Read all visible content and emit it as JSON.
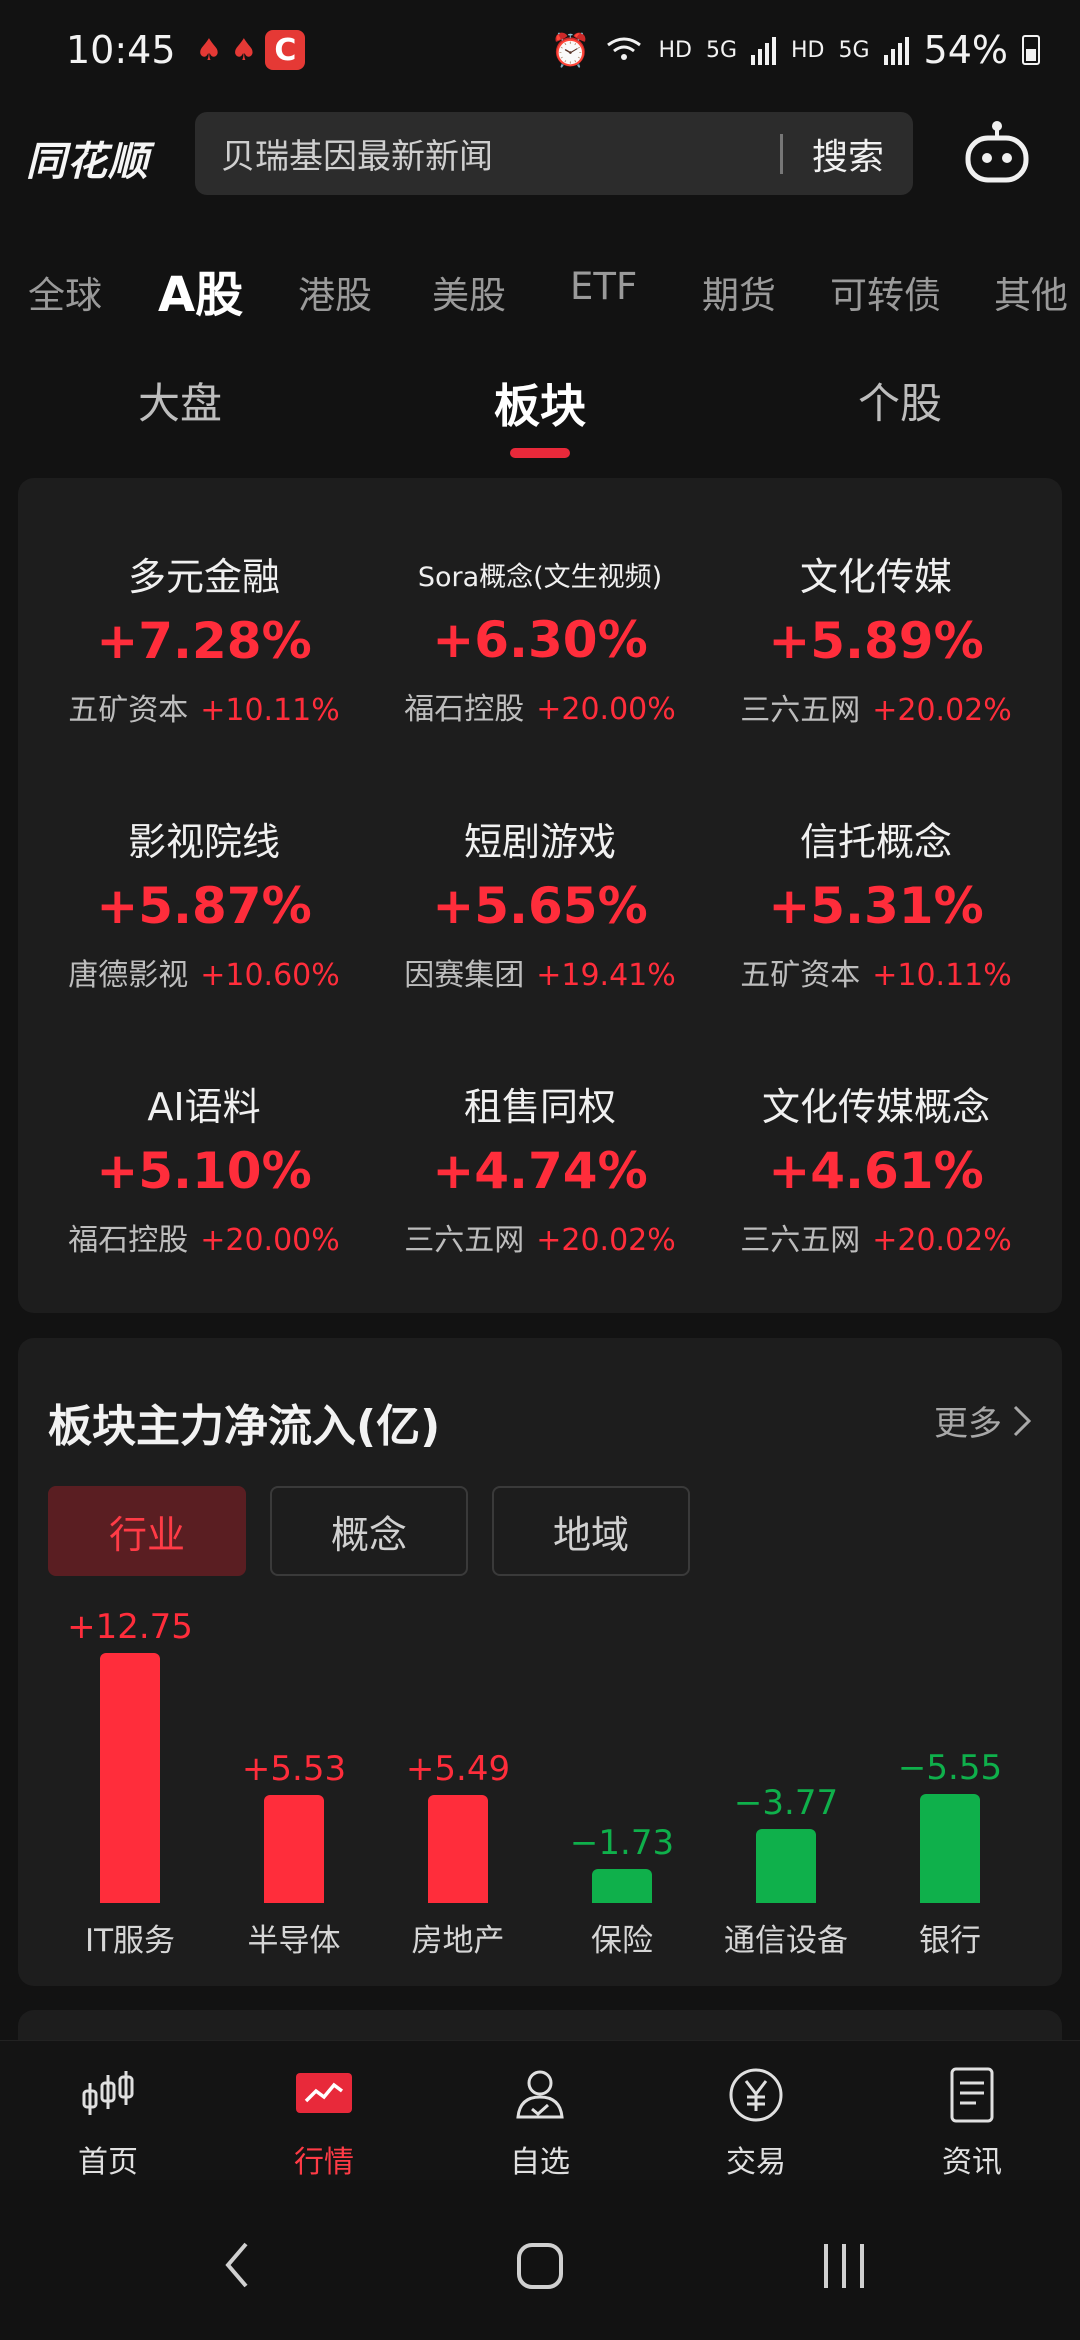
{
  "status": {
    "time": "10:45",
    "battery": "54%",
    "net1": "HD",
    "net2": "5G",
    "net3": "HD",
    "net4": "5G",
    "notif_c": "C"
  },
  "header": {
    "logo": "同花顺",
    "search_placeholder": "贝瑞基因最新新闻",
    "search_button": "搜索"
  },
  "market_tabs": [
    "全球",
    "A股",
    "港股",
    "美股",
    "ETF",
    "期货",
    "可转债",
    "其他"
  ],
  "sub_tabs": [
    "大盘",
    "板块",
    "个股"
  ],
  "sectors": [
    {
      "name": "多元金融",
      "pct": "+7.28%",
      "stock": "五矿资本",
      "stock_pct": "+10.11%"
    },
    {
      "name": "Sora概念(文生视频)",
      "pct": "+6.30%",
      "stock": "福石控股",
      "stock_pct": "+20.00%"
    },
    {
      "name": "文化传媒",
      "pct": "+5.89%",
      "stock": "三六五网",
      "stock_pct": "+20.02%"
    },
    {
      "name": "影视院线",
      "pct": "+5.87%",
      "stock": "唐德影视",
      "stock_pct": "+10.60%"
    },
    {
      "name": "短剧游戏",
      "pct": "+5.65%",
      "stock": "因赛集团",
      "stock_pct": "+19.41%"
    },
    {
      "name": "信托概念",
      "pct": "+5.31%",
      "stock": "五矿资本",
      "stock_pct": "+10.11%"
    },
    {
      "name": "AI语料",
      "pct": "+5.10%",
      "stock": "福石控股",
      "stock_pct": "+20.00%"
    },
    {
      "name": "租售同权",
      "pct": "+4.74%",
      "stock": "三六五网",
      "stock_pct": "+20.02%"
    },
    {
      "name": "文化传媒概念",
      "pct": "+4.61%",
      "stock": "三六五网",
      "stock_pct": "+20.02%"
    }
  ],
  "flow": {
    "title": "板块主力净流入(亿)",
    "more": "更多",
    "tabs": [
      "行业",
      "概念",
      "地域"
    ]
  },
  "chart_data": {
    "type": "bar",
    "categories": [
      "IT服务",
      "半导体",
      "房地产",
      "保险",
      "通信设备",
      "银行"
    ],
    "values": [
      12.75,
      5.53,
      5.49,
      -1.73,
      -3.77,
      -5.55
    ],
    "value_labels": [
      "+12.75",
      "+5.53",
      "+5.49",
      "−1.73",
      "−3.77",
      "−5.55"
    ],
    "positive_color": "#ff2d3b",
    "negative_color": "#0fb04b"
  },
  "bottom_nav": [
    "首页",
    "行情",
    "自选",
    "交易",
    "资讯"
  ],
  "colors": {
    "up": "#ff2d3b",
    "down": "#0fb04b",
    "accent": "#e8293a"
  }
}
